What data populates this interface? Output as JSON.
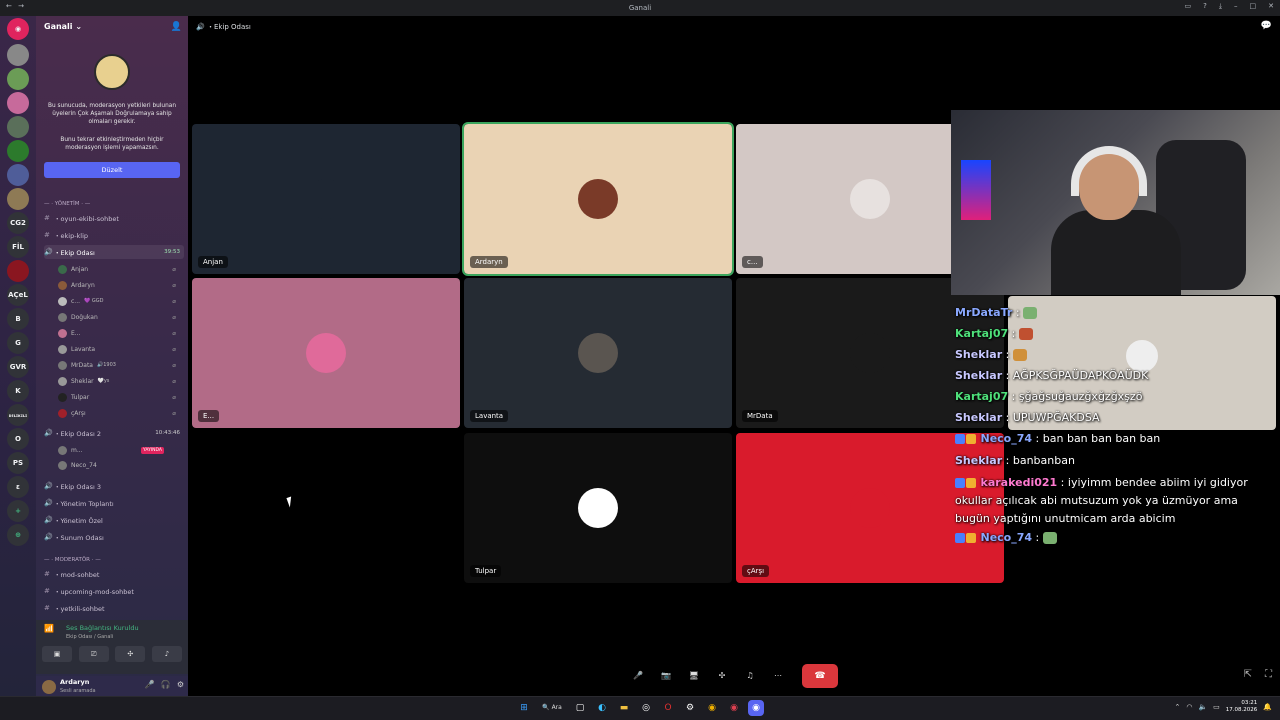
{
  "titlebar": {
    "title": "Ganali",
    "icon": "discord-icon"
  },
  "server": {
    "name": "Ganali ⌄",
    "icons": [
      "discord",
      "avatar-1",
      "avatar-2",
      "avatar-3",
      "avatar-4",
      "avatar-5",
      "avatar-6",
      "avatar-7",
      "avatar-8"
    ],
    "text_icons": [
      "CG2",
      "FİL",
      "AÇeL",
      "B",
      "G",
      "GVR",
      "K",
      "ᴅᴇʟɪᴋɪʟɪ",
      "O",
      "PS",
      "ε"
    ]
  },
  "notice": {
    "text1": "Bu sunucuda, moderasyon yetkileri bulunan üyelerin Çok Aşamalı Doğrulamaya sahip olmaları gerekir.",
    "text2": "Bunu tekrar etkinleştirmeden hiçbir moderasyon işlemi yapamazsın.",
    "button": "Düzelt"
  },
  "channels": {
    "cat_yonetim": "— · YÖNETİM · —",
    "oyun": "・oyun-ekibi-sohbet",
    "ekip_klip": "・ekip-klip",
    "ekip_odasi": "・Ekip Odası",
    "ekip_odasi_time": "39:53",
    "users": [
      {
        "name": "Anjan",
        "extra": ""
      },
      {
        "name": "Ardaryn",
        "extra": ""
      },
      {
        "name": "c...",
        "extra": "💜 GGD"
      },
      {
        "name": "Doğukan",
        "extra": ""
      },
      {
        "name": "E...",
        "extra": ""
      },
      {
        "name": "Lavanta",
        "extra": ""
      },
      {
        "name": "MrData",
        "extra": "🔊1903"
      },
      {
        "name": "Sheklar",
        "extra": "🤍ys"
      },
      {
        "name": "Tulpar",
        "extra": ""
      },
      {
        "name": "çArşı",
        "extra": ""
      }
    ],
    "ekip_odasi2": "・Ekip Odası 2",
    "ekip_odasi2_time": "10:43:46",
    "users2": [
      {
        "name": "m...",
        "badge": "YAYINDA"
      },
      {
        "name": "Neco_74",
        "badge": ""
      }
    ],
    "ekip_odasi3": "・Ekip Odası 3",
    "yonetim_toplanti": "・Yönetim Toplantı",
    "yonetim_ozel": "・Yönetim Özel",
    "sunum": "・Sunum Odası",
    "cat_moderator": "— · MODERATÖR · —",
    "mod_sohbet": "・mod-sohbet",
    "upcoming": "・upcoming-mod-sohbet",
    "yetkili": "・yetkili-sohbet"
  },
  "voice": {
    "status": "Ses Bağlantısı Kuruldu",
    "sub": "Ekip Odası / Ganali"
  },
  "me": {
    "name": "Ardaryn",
    "status": "Sesli aramada"
  },
  "stage": {
    "channel": "・Ekip Odası"
  },
  "tiles": [
    {
      "label": "Anjan",
      "bg": "#1e2632"
    },
    {
      "label": "Ardaryn",
      "bg": "#ead3b4"
    },
    {
      "label": "c...",
      "bg": "#d3c8c5"
    },
    {
      "label": "E...",
      "bg": "#b26b87"
    },
    {
      "label": "Lavanta",
      "bg": "#252b33"
    },
    {
      "label": "MrData",
      "bg": "#1a1a1a"
    },
    {
      "label": "Tulpar",
      "bg": "#0e0e0e"
    },
    {
      "label": "çArşı",
      "bg": "#d91b2c"
    }
  ],
  "chat": [
    {
      "name": "MrDataTr",
      "text": "",
      "color": "#8aa8ff",
      "icons": 0
    },
    {
      "name": "Kartaj07",
      "text": "",
      "color": "#4ee07a",
      "icons": 0
    },
    {
      "name": "Sheklar",
      "text": "",
      "color": "#c8c8ff",
      "icons": 0
    },
    {
      "name": "Sheklar",
      "text": "AĞPKSĞPAÜDAPKÖAÜDK",
      "color": "#c8c8ff",
      "icons": 0
    },
    {
      "name": "Kartaj07",
      "text": "şğağsuğauzğxğzğxşzö",
      "color": "#4ee07a",
      "icons": 0
    },
    {
      "name": "Sheklar",
      "text": "UPUWPĞAKDSA",
      "color": "#c8c8ff",
      "icons": 0
    },
    {
      "name": "Neco_74",
      "text": "ban ban ban ban ban",
      "color": "#8aa8ff",
      "icons": 2
    },
    {
      "name": "Sheklar",
      "text": "banbanban",
      "color": "#c8c8ff",
      "icons": 0
    },
    {
      "name": "karakedi021",
      "text": "iyiyimm bendee abiim iyi gidiyor okullar açılıcak abi mutsuzum yok ya üzmüyor ama bugün yaptığını unutmicam arda abicim",
      "color": "#ff7ad0",
      "icons": 2
    },
    {
      "name": "Neco_74",
      "text": "",
      "color": "#8aa8ff",
      "icons": 2
    }
  ],
  "taskbar": {
    "search": "Ara",
    "time": "03:21",
    "date": "17.08.2026"
  }
}
